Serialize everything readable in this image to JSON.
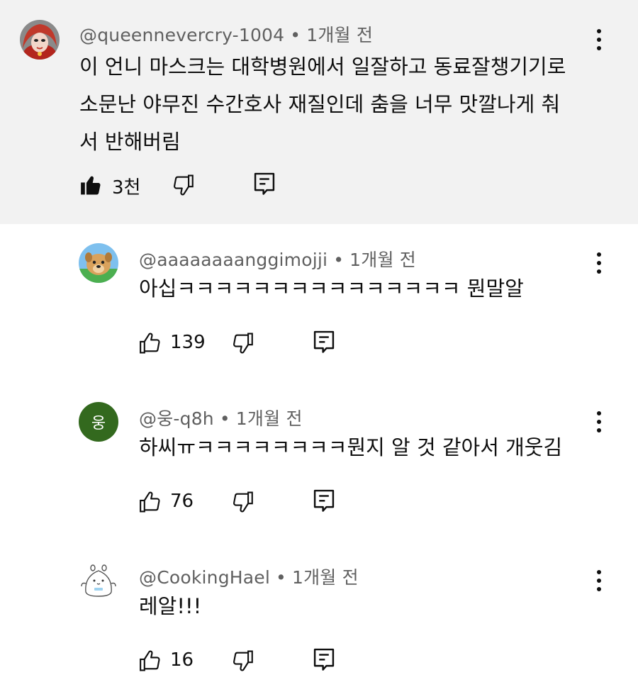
{
  "comments": [
    {
      "handle": "@queennevercry-1004",
      "separator": "•",
      "time": "1개월 전",
      "text": "이 언니 마스크는 대학병원에서 일잘하고 동료잘챙기기로\n소문난 야무진 수간호사 재질인데 춤을 너무 맛깔나게 춰\n서 반해버림",
      "likes": "3천",
      "liked": true,
      "avatar": "drag-queen-avatar"
    },
    {
      "handle": "@aaaaaaaanggimojji",
      "separator": "•",
      "time": "1개월 전",
      "text": "아십ㅋㅋㅋㅋㅋㅋㅋㅋㅋㅋㅋㅋㅋㅋㅋ 뭔말알",
      "likes": "139",
      "liked": false,
      "avatar": "dog-avatar"
    },
    {
      "handle": "@웅-q8h",
      "separator": "•",
      "time": "1개월 전",
      "text": "하씨ㅠㅋㅋㅋㅋㅋㅋㅋㅋ뭔지 알 것 같아서 개웃김",
      "likes": "76",
      "liked": false,
      "avatar_letter": "웅",
      "avatar_color": "#33691e"
    },
    {
      "handle": "@CookingHael",
      "separator": "•",
      "time": "1개월 전",
      "text": "레알!!!",
      "likes": "16",
      "liked": false,
      "avatar": "cartoon-avatar"
    }
  ],
  "icons": {
    "like": "thumbs-up-icon",
    "dislike": "thumbs-down-icon",
    "reply": "reply-icon",
    "more": "more-vertical-icon"
  },
  "colors": {
    "highlight_bg": "#f2f2f2",
    "meta_text": "#606060",
    "text": "#0f0f0f"
  }
}
